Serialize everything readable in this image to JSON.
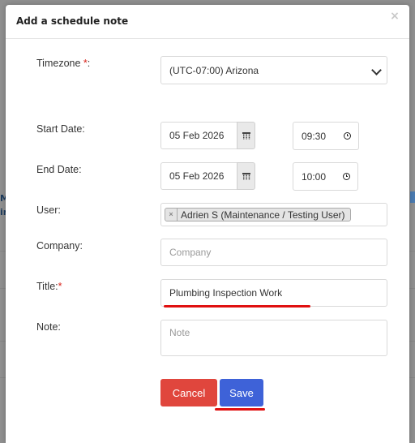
{
  "modal": {
    "title": "Add a schedule note",
    "close_glyph": "×"
  },
  "form": {
    "timezone": {
      "label": "Timezone ",
      "required_mark": "*",
      "label_suffix": ":",
      "value": "(UTC-07:00) Arizona"
    },
    "start_date": {
      "label": "Start Date:",
      "date": "05 Feb 2026",
      "time": "09:30"
    },
    "end_date": {
      "label": "End Date:",
      "date": "05 Feb 2026",
      "time": "10:00"
    },
    "user": {
      "label": "User:",
      "tag": "Adrien S (Maintenance / Testing User)",
      "tag_remove": "×"
    },
    "company": {
      "label": "Company:",
      "placeholder": "Company"
    },
    "title": {
      "label": "Title:",
      "required_mark": "*",
      "value": "Plumbing Inspection Work"
    },
    "note": {
      "label": "Note:",
      "placeholder": "Note"
    }
  },
  "buttons": {
    "cancel": "Cancel",
    "save": "Save"
  },
  "background": {
    "left_fragment_1": "M",
    "left_fragment_2": "ir"
  },
  "colors": {
    "accent": "#3e62d8",
    "danger": "#e0463d",
    "annotation": "#e01010"
  },
  "icons": {
    "calendar": "calendar-icon",
    "clock": "clock-icon",
    "chevron": "chevron-down-icon"
  }
}
